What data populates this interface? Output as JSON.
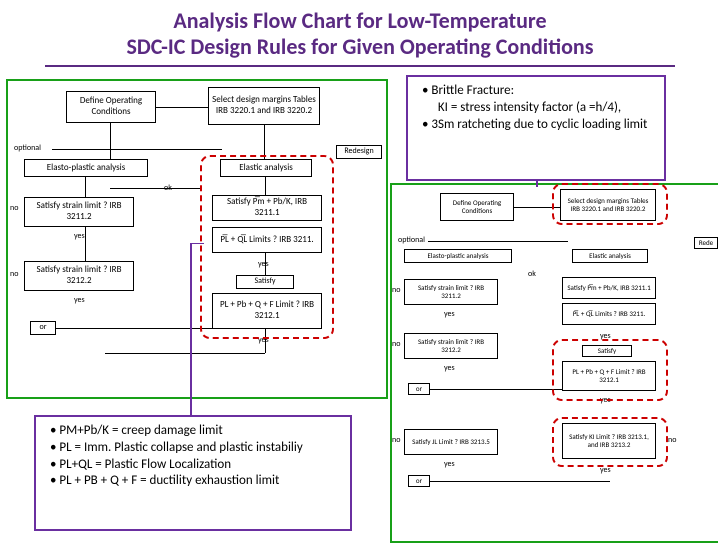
{
  "title_line1": "Analysis Flow Chart for Low-Temperature",
  "title_line2": "SDC-IC Design Rules for Given Operating Conditions",
  "annot_top": {
    "b1": "Brittle Fracture:",
    "b1b": "KI = stress intensity factor (a =h/4),",
    "b2": "3Sm ratcheting due to cyclic loading limit"
  },
  "annot_bottom": {
    "b1": "PM+Pb/K =  creep damage limit",
    "b2": "PL = Imm. Plastic collapse and plastic instabiliy",
    "b3": "PL+QL = Plastic Flow Localization",
    "b4": "PL + PB + Q + F  =  ductility exhaustion limit"
  },
  "left": {
    "defop": "Define Operating Conditions",
    "selmar": "Select design margins Tables IRB 3220.1 and IRB 3220.2",
    "elasto": "Elasto-plastic analysis",
    "elastic": "Elastic analysis",
    "redesign": "Redesign",
    "optional": "optional",
    "ok": "ok",
    "no": "no",
    "yes": "yes",
    "or": "or",
    "strain1": "Satisfy strain limit ? IRB 3211.2",
    "strain2": "Satisfy strain limit ? IRB 3212.2",
    "pmpbk": "Satisfy P̅m + Pb/K, IRB 3211.1",
    "plql": "P̅L + Q̅L Limits ? IRB 3211.",
    "satisfy": "Satisfy",
    "plpbqf": "PL + Pb + Q + F Limit ? IRB 3212.1"
  },
  "right": {
    "defop": "Define Operating Conditions",
    "selmar": "Select design margins Tables IRB 3220.1 and IRB 3220.2",
    "elasto": "Elasto-plastic analysis",
    "elastic": "Elastic analysis",
    "redesign": "Rede",
    "optional": "optional",
    "ok": "ok",
    "no": "no",
    "yes": "yes",
    "or": "or",
    "strain1": "Satisfy strain limit ? IRB 3211.2",
    "strain2": "Satisfy strain limit ? IRB 3212.2",
    "pmpbk": "Satisfy P̅m + Pb/K, IRB 3211.1",
    "plql": "P̅L + Q̅L Limits ? IRB 3211.",
    "satisfy": "Satisfy",
    "plpbqf": "PL + Pb + Q + F Limit ? IRB 3212.1",
    "jl": "Satisfy JL Limit ? IRB 3213.5",
    "kl": "Satisfy KI Limit ? IRB 3213.1, and IRB 3213.2"
  }
}
